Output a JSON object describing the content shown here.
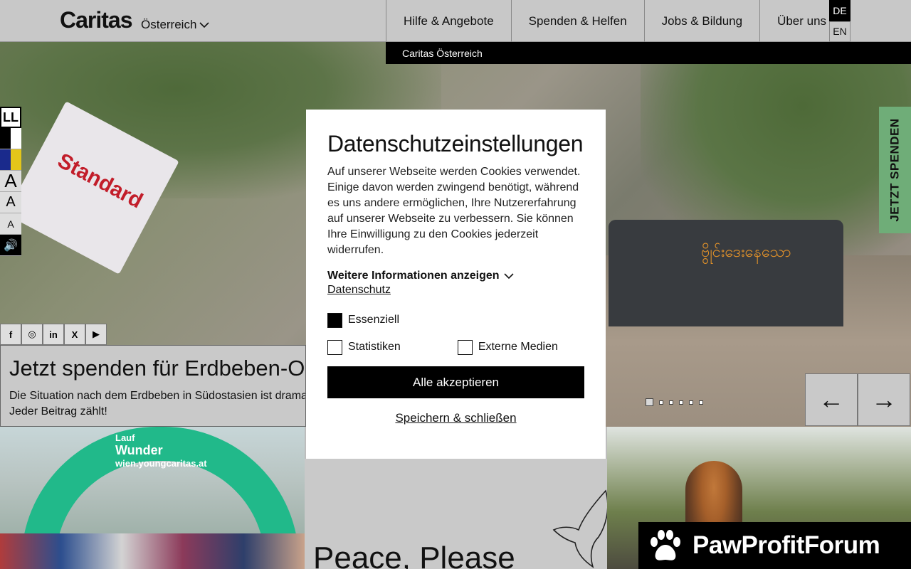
{
  "header": {
    "logo": "Caritas",
    "country": "Österreich",
    "nav": [
      "Hilfe & Angebote",
      "Spenden & Helfen",
      "Jobs & Bildung",
      "Über uns"
    ],
    "lang_active": "DE",
    "lang_other": "EN",
    "subnav_item": "Caritas Österreich"
  },
  "a11y": {
    "ll_label": "LL",
    "font_large": "A",
    "font_medium": "A",
    "font_small": "A",
    "speaker": "🔊"
  },
  "social": [
    "f",
    "◎",
    "in",
    "X",
    "▶"
  ],
  "hero": {
    "sign_text": "Standard",
    "tank_text": "ဗွိုင်းဒေးနေသော",
    "title": "Jetzt spenden für Erdbeben-Opfer",
    "text": "Die Situation nach dem Erdbeben in Südostasien ist dramatisch. Jeder Beitrag zählt!",
    "prev_arrow": "←",
    "next_arrow": "→",
    "slide_count": 6,
    "active_slide": 1
  },
  "donate_tab": "JETZT SPENDEN",
  "cards": {
    "arch_line1": "Lauf",
    "arch_line2": "Wunder",
    "arch_line3": "wien.youngcaritas.at",
    "peace_title": "Peace, Please"
  },
  "brand_banner": "PawProfitForum",
  "modal": {
    "title": "Datenschutzeinstellungen",
    "description": "Auf unserer Webseite werden Cookies verwendet. Einige davon werden zwingend benötigt, während es uns andere ermöglichen, Ihre Nutzererfahrung auf unserer Webseite zu verbessern. Sie können Ihre Einwilligung zu den Cookies jederzeit widerrufen.",
    "more_info": "Weitere Informationen anzeigen",
    "privacy_link": "Datenschutz",
    "essential": "Essenziell",
    "statistics": "Statistiken",
    "external_media": "Externe Medien",
    "accept_all": "Alle akzeptieren",
    "save_close": "Speichern & schließen"
  }
}
